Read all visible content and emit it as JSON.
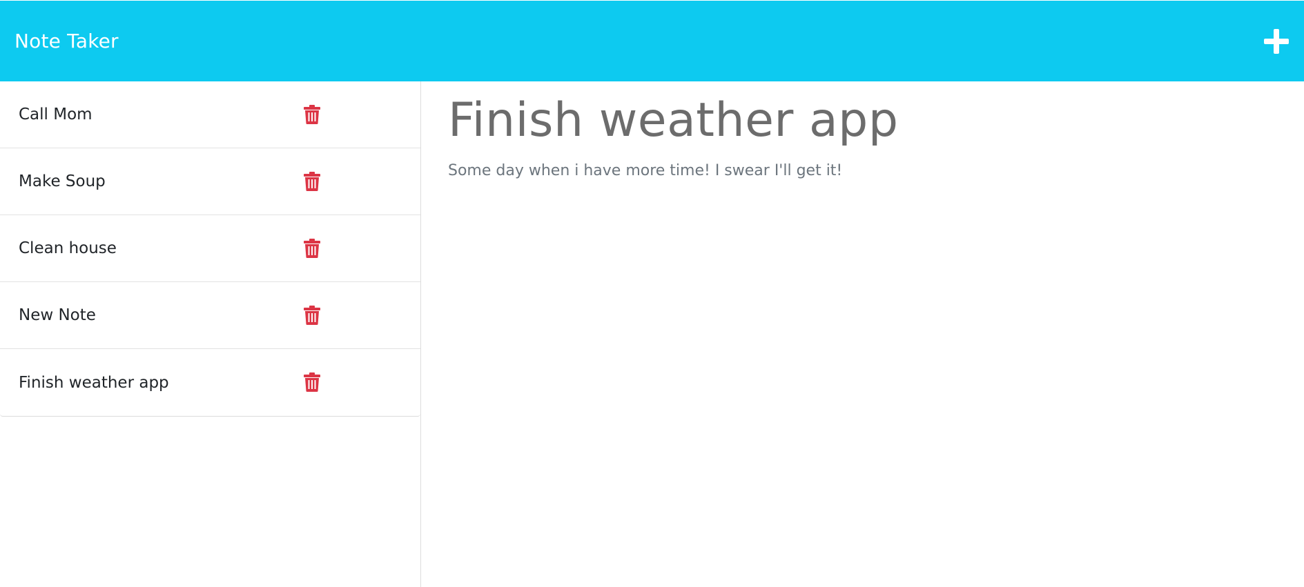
{
  "app": {
    "title": "Note Taker"
  },
  "toolbar": {
    "add_icon": "plus-icon"
  },
  "notes": [
    {
      "title": "Call Mom"
    },
    {
      "title": "Make Soup"
    },
    {
      "title": "Clean house"
    },
    {
      "title": "New Note"
    },
    {
      "title": "Finish weather app"
    }
  ],
  "active_note": {
    "title": "Finish weather app",
    "text": "Some day when i have more time! I swear I'll get it!"
  },
  "icons": {
    "delete": "trash-icon"
  },
  "colors": {
    "navbar": "#0dcaf0",
    "delete": "#dc3545",
    "heading": "#6c6c6c",
    "body_text": "#6c757d"
  }
}
